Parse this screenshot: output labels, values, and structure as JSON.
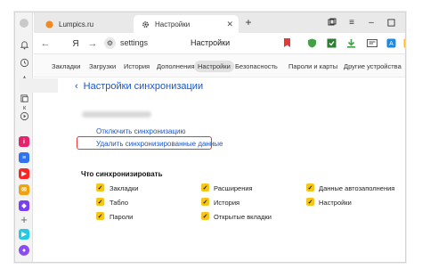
{
  "tabs": [
    {
      "label": "Lumpics.ru",
      "icon": "lumpics-icon",
      "active": false
    },
    {
      "label": "Настройки",
      "icon": "gear-icon",
      "active": true
    }
  ],
  "address": {
    "url": "settings",
    "page_title": "Настройки",
    "yandex_button": "Я"
  },
  "settings_nav": [
    {
      "label": "Закладки"
    },
    {
      "label": "Загрузки"
    },
    {
      "label": "История"
    },
    {
      "label": "Дополнения"
    },
    {
      "label": "Настройки",
      "active": true
    },
    {
      "label": "Безопасность"
    },
    {
      "label": "Пароли и карты"
    },
    {
      "label": "Другие устройства"
    }
  ],
  "sidebar_stub": {
    "label": "к"
  },
  "content": {
    "title": "Настройки синхронизации",
    "disable_link": "Отключить синхронизацию",
    "delete_link": "Удалить синхронизированные данные",
    "section_title": "Что синхронизировать",
    "items": [
      {
        "label": "Закладки",
        "checked": true
      },
      {
        "label": "Расширения",
        "checked": true
      },
      {
        "label": "Данные автозаполнения",
        "checked": true
      },
      {
        "label": "Табло",
        "checked": true
      },
      {
        "label": "История",
        "checked": true
      },
      {
        "label": "Настройки",
        "checked": true
      },
      {
        "label": "Пароли",
        "checked": true
      },
      {
        "label": "Открытые вкладки",
        "checked": true
      }
    ]
  },
  "colors": {
    "accent_link": "#1a56c8",
    "checkbox": "#f5c518",
    "highlight": "#e03c3c"
  }
}
